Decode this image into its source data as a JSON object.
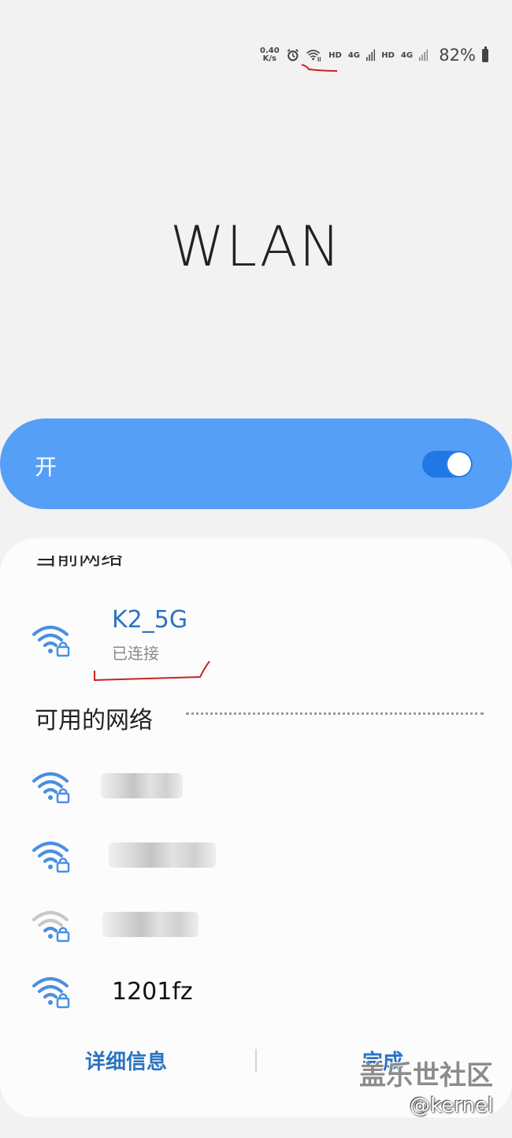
{
  "status_bar": {
    "net_speed_value": "0.40",
    "net_speed_unit": "K/s",
    "hd1": "HD",
    "signal1_label": "4G",
    "hd2": "HD",
    "signal2_label": "4G",
    "battery": "82%"
  },
  "page_title": "WLAN",
  "master_toggle": {
    "label": "开",
    "state": "on"
  },
  "current_network": {
    "section_label": "当前网络",
    "name": "K2_5G",
    "status": "已连接"
  },
  "available_section": {
    "title": "可用的网络"
  },
  "available_networks": [
    {
      "name": "",
      "obscured": true,
      "signal": "strong",
      "secured": true
    },
    {
      "name": "",
      "obscured": true,
      "signal": "strong",
      "secured": true
    },
    {
      "name": "",
      "obscured": true,
      "signal": "weak",
      "secured": true
    },
    {
      "name": "1201fz",
      "obscured": false,
      "signal": "strong",
      "secured": true
    }
  ],
  "actions": {
    "details": "详细信息",
    "done": "完成"
  },
  "watermark": {
    "brand": "盖乐世社区",
    "user": "@kernel"
  },
  "colors": {
    "accent": "#559ff6",
    "link": "#2b73c2",
    "switch_track": "#1f78e6",
    "annotation": "#cc2222"
  }
}
